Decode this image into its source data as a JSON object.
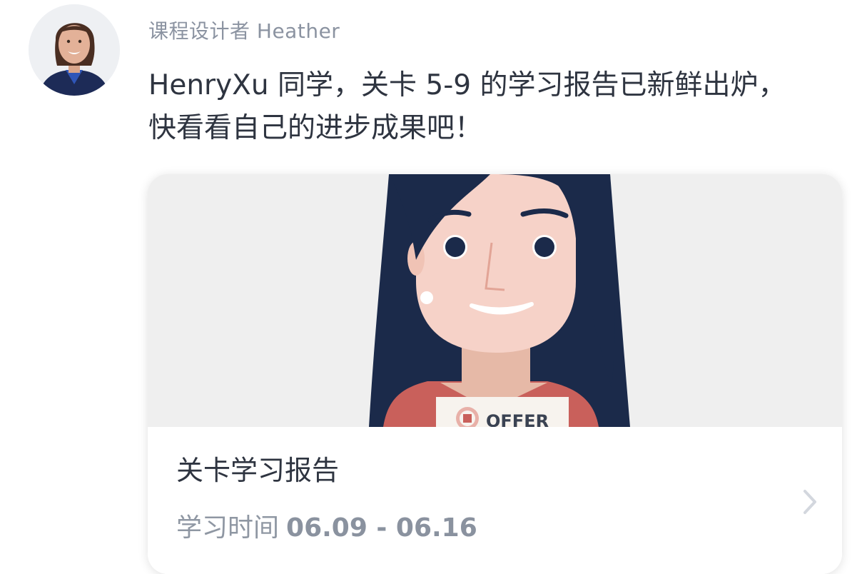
{
  "sender": {
    "name": "课程设计者 Heather",
    "avatar_icon": "designer-avatar"
  },
  "message": {
    "line1": "HenryXu 同学，关卡 5-9 的学习报告已新鲜出炉，",
    "line2": "快看看自己的进步成果吧！"
  },
  "report_card": {
    "cover_icon": "offer-illustration",
    "badge_text": "OFFER",
    "title": "关卡学习报告",
    "time_label": "学习时间",
    "time_range": "06.09 - 06.16",
    "chevron_icon": "chevron-right-icon"
  },
  "colors": {
    "hair": "#1b2a4a",
    "skin": "#f6d2c8",
    "cover_bg": "#efefef",
    "shirt": "#c9605b",
    "text_primary": "#2e3440",
    "text_secondary": "#8b93a1"
  }
}
